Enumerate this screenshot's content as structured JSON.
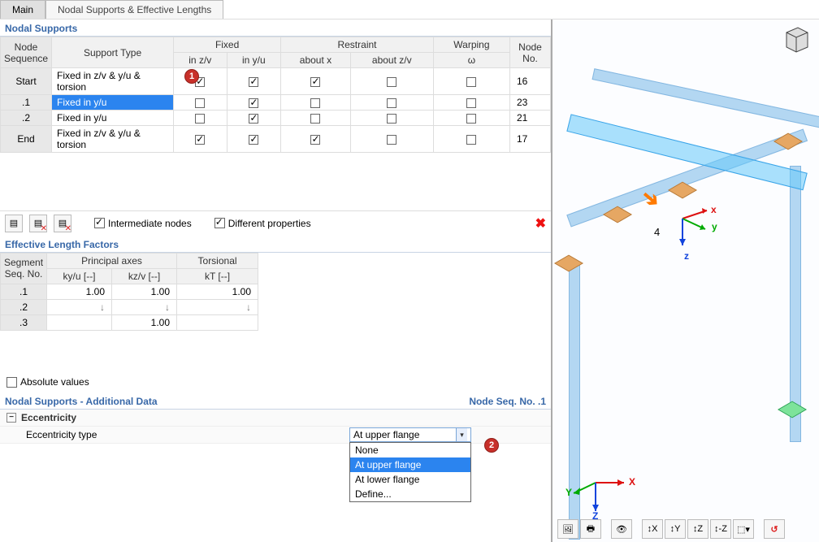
{
  "tabs": {
    "main": "Main",
    "nodal": "Nodal Supports & Effective Lengths"
  },
  "section1_title": "Nodal Supports",
  "table1_headers": {
    "seq": "Node\nSequence",
    "type": "Support Type",
    "fixed": "Fixed",
    "restraint": "Restraint",
    "warping": "Warping",
    "node_no": "Node\nNo.",
    "zv": "in z/v",
    "yu": "in y/u",
    "aboutx": "about x",
    "aboutzv": "about z/v",
    "omega": "ω"
  },
  "supports": [
    {
      "seq": "Start",
      "type": "Fixed in z/v & y/u & torsion",
      "zv": true,
      "yu": true,
      "ax": true,
      "azv": false,
      "w": false,
      "node": "16",
      "sel": false
    },
    {
      "seq": ".1",
      "type": "Fixed in y/u",
      "zv": false,
      "yu": true,
      "ax": false,
      "azv": false,
      "w": false,
      "node": "23",
      "sel": true
    },
    {
      "seq": ".2",
      "type": "Fixed in y/u",
      "zv": false,
      "yu": true,
      "ax": false,
      "azv": false,
      "w": false,
      "node": "21",
      "sel": false
    },
    {
      "seq": "End",
      "type": "Fixed in z/v & y/u & torsion",
      "zv": true,
      "yu": true,
      "ax": true,
      "azv": false,
      "w": false,
      "node": "17",
      "sel": false
    }
  ],
  "intermediate_nodes_label": "Intermediate nodes",
  "different_props_label": "Different properties",
  "section2_title": "Effective Length Factors",
  "table2_headers": {
    "seq": "Segment\nSeq. No.",
    "principal": "Principal axes",
    "torsional": "Torsional",
    "kyu": "ky/u [--]",
    "kzv": "kz/v [--]",
    "kt": "kT [--]"
  },
  "lengths": [
    {
      "seq": ".1",
      "kyu": "1.00",
      "kzv": "1.00",
      "kt": "1.00"
    },
    {
      "seq": ".2",
      "kyu": "↓",
      "kzv": "↓",
      "kt": "↓"
    },
    {
      "seq": ".3",
      "kyu": "",
      "kzv": "1.00",
      "kt": ""
    }
  ],
  "absolute_values_label": "Absolute values",
  "additional_title": "Nodal Supports - Additional Data",
  "additional_sub": "Node Seq. No. .1",
  "ecc_group": "Eccentricity",
  "ecc_label": "Eccentricity type",
  "dd_selected": "At upper flange",
  "dd_options": [
    "None",
    "At upper flange",
    "At lower flange",
    "Define..."
  ],
  "callout1": "1",
  "callout2": "2",
  "vp_label_4": "4",
  "axis_labels": {
    "x": "X",
    "y": "Y",
    "z": "Z",
    "lx": "x",
    "ly": "y",
    "lz": "z"
  }
}
